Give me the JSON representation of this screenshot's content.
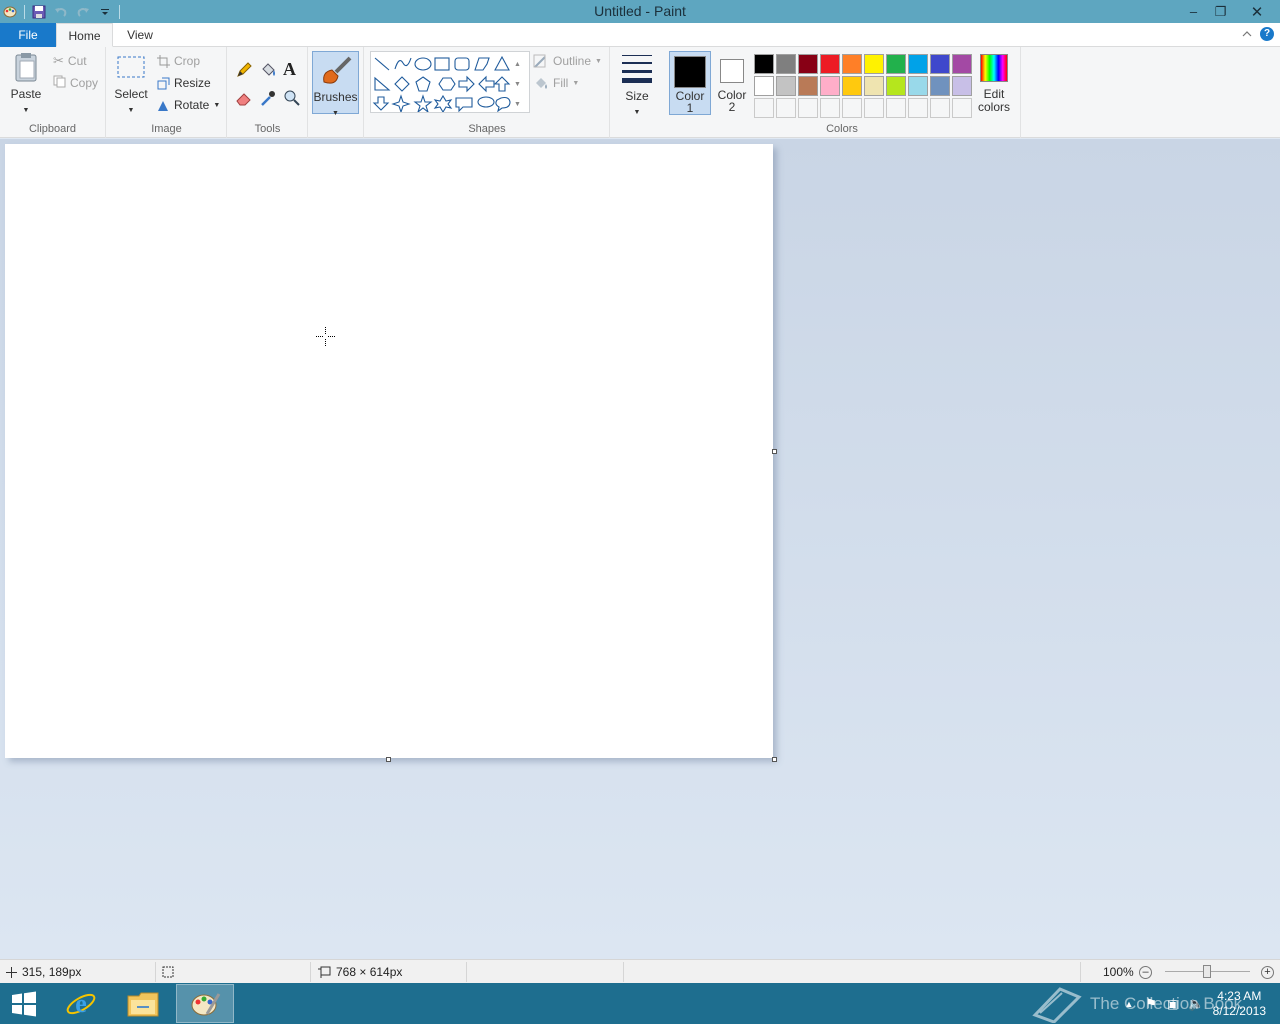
{
  "window": {
    "title": "Untitled - Paint"
  },
  "tabs": {
    "file": "File",
    "home": "Home",
    "view": "View"
  },
  "clipboard": {
    "paste": "Paste",
    "cut": "Cut",
    "copy": "Copy",
    "label": "Clipboard"
  },
  "image": {
    "select": "Select",
    "crop": "Crop",
    "resize": "Resize",
    "rotate": "Rotate",
    "label": "Image"
  },
  "tools": {
    "label": "Tools"
  },
  "brushes": {
    "label": "Brushes"
  },
  "shapes": {
    "outline": "Outline",
    "fill": "Fill",
    "label": "Shapes"
  },
  "size": {
    "label": "Size"
  },
  "colors": {
    "color1_label": "Color",
    "color1_num": "1",
    "color2_label": "Color",
    "color2_num": "2",
    "edit_label": "Edit",
    "edit_label2": "colors",
    "label": "Colors",
    "color1_value": "#000000",
    "color2_value": "#ffffff",
    "palette": [
      "#000000",
      "#7f7f7f",
      "#880015",
      "#ed1c24",
      "#ff7f27",
      "#fff200",
      "#22b14c",
      "#00a2e8",
      "#3f48cc",
      "#a349a4",
      "#ffffff",
      "#c3c3c3",
      "#b97a57",
      "#ffaec9",
      "#ffc90e",
      "#efe4b0",
      "#b5e61d",
      "#99d9ea",
      "#7092be",
      "#c8bfe7"
    ]
  },
  "status": {
    "cursor_pos": "315, 189px",
    "canvas_size": "768 × 614px",
    "zoom": "100%"
  },
  "taskbar": {
    "time": "4:23 AM",
    "date": "8/12/2013",
    "watermark": "The Collection Book"
  }
}
